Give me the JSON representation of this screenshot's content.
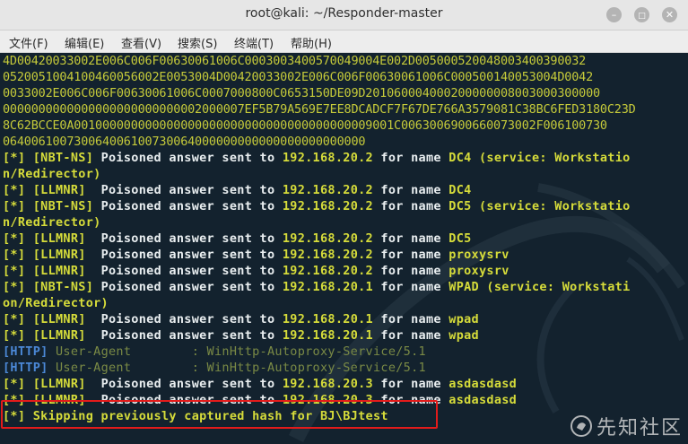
{
  "window": {
    "title": "root@kali: ~/Responder-master"
  },
  "menu": [
    "文件(F)",
    "编辑(E)",
    "查看(V)",
    "搜索(S)",
    "终端(T)",
    "帮助(H)"
  ],
  "terminal": {
    "hex_lines": [
      "4D00420033002E006C006F00630061006C0003003400570049004E002D005000520048003400390032",
      "0520051004100460056002E0053004D00420033002E006C006F00630061006C000500140053004D0042",
      "0033002E006C006F00630061006C0007000800C0653150DE09D201060004000200000008003000300000",
      "0000000000000000000000000002000007EF5B79A569E7EE8DCADCF7F67DE766A3579081C38BC6FED3180C23D",
      "8C62BCCE0A001000000000000000000000000000000000000009001C0063006900660073002F006100730",
      "064006100730064006100730064000000000000000000000000"
    ],
    "lines": [
      {
        "tag": "[*]",
        "proto": "[NBT-NS]",
        "rest": " Poisoned answer sent to ",
        "ip": "192.168.20.2",
        "rest2": " for name ",
        "target": "DC4",
        "tail": " (service: Workstatio"
      },
      {
        "cont": "n/Redirector)"
      },
      {
        "tag": "[*]",
        "proto": "[LLMNR]",
        "rest": "  Poisoned answer sent to ",
        "ip": "192.168.20.2",
        "rest2": " for name ",
        "target": "DC4",
        "tail": ""
      },
      {
        "tag": "[*]",
        "proto": "[NBT-NS]",
        "rest": " Poisoned answer sent to ",
        "ip": "192.168.20.2",
        "rest2": " for name ",
        "target": "DC5",
        "tail": " (service: Workstatio"
      },
      {
        "cont": "n/Redirector)"
      },
      {
        "tag": "[*]",
        "proto": "[LLMNR]",
        "rest": "  Poisoned answer sent to ",
        "ip": "192.168.20.2",
        "rest2": " for name ",
        "target": "DC5",
        "tail": ""
      },
      {
        "tag": "[*]",
        "proto": "[LLMNR]",
        "rest": "  Poisoned answer sent to ",
        "ip": "192.168.20.2",
        "rest2": " for name ",
        "target": "proxysrv",
        "tail": ""
      },
      {
        "tag": "[*]",
        "proto": "[LLMNR]",
        "rest": "  Poisoned answer sent to ",
        "ip": "192.168.20.2",
        "rest2": " for name ",
        "target": "proxysrv",
        "tail": ""
      },
      {
        "tag": "[*]",
        "proto": "[NBT-NS]",
        "rest": " Poisoned answer sent to ",
        "ip": "192.168.20.1",
        "rest2": " for name ",
        "target": "WPAD",
        "tail": " (service: Workstati"
      },
      {
        "cont": "on/Redirector)"
      },
      {
        "tag": "[*]",
        "proto": "[LLMNR]",
        "rest": "  Poisoned answer sent to ",
        "ip": "192.168.20.1",
        "rest2": " for name ",
        "target": "wpad",
        "tail": ""
      },
      {
        "tag": "[*]",
        "proto": "[LLMNR]",
        "rest": "  Poisoned answer sent to ",
        "ip": "192.168.20.1",
        "rest2": " for name ",
        "target": "wpad",
        "tail": ""
      },
      {
        "http": "[HTTP]",
        "text": " User-Agent        : WinHttp-Autoproxy-Service/5.1"
      },
      {
        "http": "[HTTP]",
        "text": " User-Agent        : WinHttp-Autoproxy-Service/5.1"
      },
      {
        "tag": "[*]",
        "proto": "[LLMNR]",
        "rest": "  Poisoned answer sent to ",
        "ip": "192.168.20.3",
        "rest2": " for name ",
        "target": "asdasdasd",
        "tail": ""
      },
      {
        "tag": "[*]",
        "proto": "[LLMNR]",
        "rest": "  Poisoned answer sent to ",
        "ip": "192.168.20.3",
        "rest2": " for name ",
        "target": "asdasdasd",
        "tail": ""
      },
      {
        "skip": "[*] Skipping previously captured hash for BJ\\BJtest"
      }
    ]
  },
  "watermark": "先知社区",
  "colors": {
    "terminal_bg": "#13222e",
    "accent_yellow": "#d6dc3a",
    "http_blue": "#4b88d6",
    "highlight_red": "#e21b1b"
  }
}
